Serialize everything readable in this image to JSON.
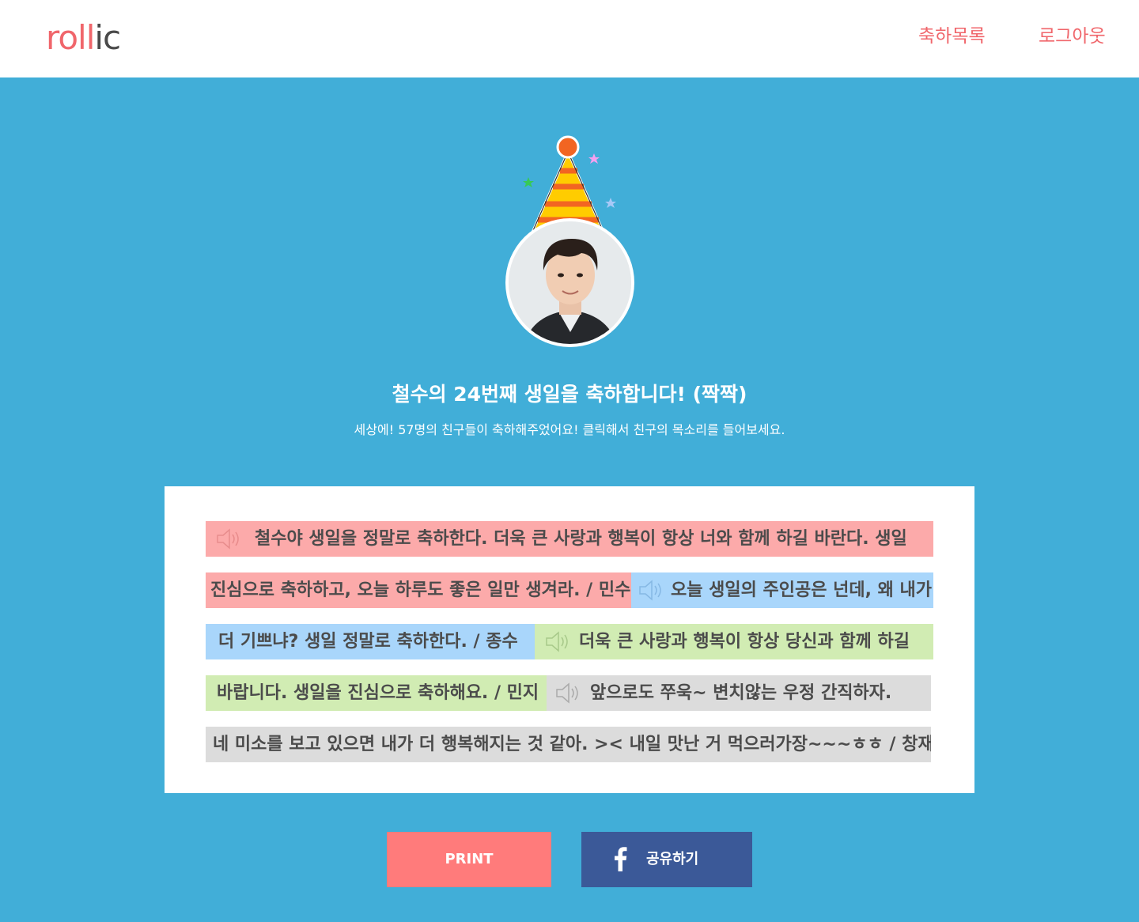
{
  "header": {
    "logo_red": "roll",
    "logo_gray": "ic",
    "nav_list": "축하목록",
    "nav_logout": "로그아웃"
  },
  "hero": {
    "title": "철수의 24번째 생일을 축하합니다! (짝짝)",
    "subtitle": "세상에! 57명의 친구들이 축하해주었어요! 클릭해서 친구의 목소리를 들어보세요."
  },
  "messages": {
    "m1_part1": "철수야 생일을 정말로 축하한다. 더욱 큰 사랑과 행복이 항상 너와 함께 하길 바란다. 생일",
    "m1_part2": "진심으로 축하하고, 오늘 하루도 좋은 일만 생겨라. / 민수",
    "m2_part1": "오늘 생일의 주인공은 넌데, 왜 내가",
    "m2_part2": "더 기쁘냐? 생일 정말로 축하한다. / 종수",
    "m3_part1": "더욱 큰 사랑과 행복이 항상 당신과 함께 하길",
    "m3_part2": "바랍니다. 생일을 진심으로 축하해요. / 민지",
    "m4_part1": "앞으로도 쭈욱~ 변치않는 우정 간직하자.",
    "m4_part2": "네 미소를 보고 있으면 내가 더 행복해지는 것 같아. >< 내일 맛난 거 먹으러가장~~~ㅎㅎ / 창재"
  },
  "buttons": {
    "print": "PRINT",
    "share": "공유하기"
  },
  "colors": {
    "brand": "#f0666b",
    "background": "#41aed8",
    "pink": "#fcaaaa",
    "blue": "#a9d6fb",
    "green": "#d1ecb3",
    "gray": "#dcdcdc",
    "print": "#ff7b7b",
    "facebook": "#3b5998"
  },
  "icons": [
    "party-hat-icon",
    "speaker-icon",
    "facebook-icon"
  ]
}
